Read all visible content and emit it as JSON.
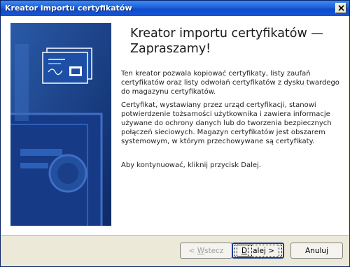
{
  "window": {
    "title": "Kreator importu certyfikatów"
  },
  "main": {
    "heading_line1": "Kreator importu certyfikatów —",
    "heading_line2": "Zapraszamy!",
    "paragraphs": [
      "Ten kreator pozwala kopiować certyfikaty, listy zaufań certyfikatów oraz listy odwołań certyfikatów z dysku twardego do magazynu certyfikatów.",
      "Certyfikat, wystawiany przez urząd certyfikacji, stanowi potwierdzenie tożsamości użytkownika i zawiera informacje używane do ochrony danych lub do tworzenia bezpiecznych połączeń sieciowych. Magazyn certyfikatów jest obszarem systemowym, w którym przechowywane są certyfikaty.",
      "Aby kontynuować, kliknij przycisk Dalej."
    ]
  },
  "buttons": {
    "back_prefix": "< ",
    "back_mnemonic": "W",
    "back_rest": "stecz",
    "next_mnemonic": "D",
    "next_rest": "alej >",
    "cancel": "Anuluj"
  },
  "colors": {
    "titlebar": "#1f5fd8",
    "sidepanel": "#1a3a7a",
    "window_bg": "#ece9d8"
  }
}
